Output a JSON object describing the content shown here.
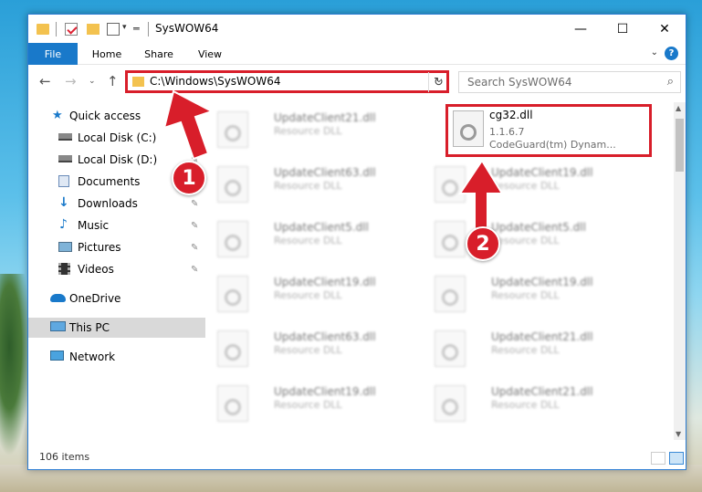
{
  "window": {
    "title": "SysWOW64",
    "minimize_glyph": "—",
    "maximize_glyph": "☐",
    "close_glyph": "✕"
  },
  "ribbon": {
    "tabs": [
      "File",
      "Home",
      "Share",
      "View"
    ]
  },
  "address": {
    "path": "C:\\Windows\\SysWOW64",
    "search_placeholder": "Search SysWOW64"
  },
  "nav": {
    "items": [
      {
        "label": "Quick access",
        "icon": "star-icon",
        "pinned": false
      },
      {
        "label": "Local Disk (C:)",
        "icon": "drive-icon",
        "pinned": true
      },
      {
        "label": "Local Disk (D:)",
        "icon": "drive-icon",
        "pinned": true
      },
      {
        "label": "Documents",
        "icon": "documents-icon",
        "pinned": true
      },
      {
        "label": "Downloads",
        "icon": "download-icon",
        "pinned": true
      },
      {
        "label": "Music",
        "icon": "music-icon",
        "pinned": true
      },
      {
        "label": "Pictures",
        "icon": "pictures-icon",
        "pinned": true
      },
      {
        "label": "Videos",
        "icon": "videos-icon",
        "pinned": true
      },
      {
        "label": "OneDrive",
        "icon": "cloud-icon",
        "pinned": false
      },
      {
        "label": "This PC",
        "icon": "computer-icon",
        "pinned": false,
        "selected": true
      },
      {
        "label": "Network",
        "icon": "network-icon",
        "pinned": false
      }
    ]
  },
  "files": {
    "highlighted": {
      "name": "cg32.dll",
      "version": "1.1.6.7",
      "description": "CodeGuard(tm) Dynam..."
    },
    "left_column": [
      {
        "name": "UpdateClient21.dll",
        "type": "Resource DLL"
      },
      {
        "name": "UpdateClient63.dll",
        "type": "Resource DLL"
      },
      {
        "name": "UpdateClient5.dll",
        "type": "Resource DLL"
      },
      {
        "name": "UpdateClient19.dll",
        "type": "Resource DLL"
      },
      {
        "name": "UpdateClient63.dll",
        "type": "Resource DLL"
      },
      {
        "name": "UpdateClient19.dll",
        "type": "Resource DLL"
      }
    ],
    "right_column": [
      {
        "name": "UpdateClient19.dll",
        "type": "Resource DLL"
      },
      {
        "name": "UpdateClient5.dll",
        "type": "Resource DLL"
      },
      {
        "name": "UpdateClient19.dll",
        "type": "Resource DLL"
      },
      {
        "name": "UpdateClient21.dll",
        "type": "Resource DLL"
      },
      {
        "name": "UpdateClient21.dll",
        "type": "Resource DLL"
      }
    ]
  },
  "status": {
    "item_count": "106 items"
  },
  "annotations": {
    "step1": "1",
    "step2": "2",
    "color": "#d81e2a"
  },
  "colors": {
    "accent": "#1979ca",
    "highlight": "#d81e2a",
    "folder": "#f3c24f"
  }
}
